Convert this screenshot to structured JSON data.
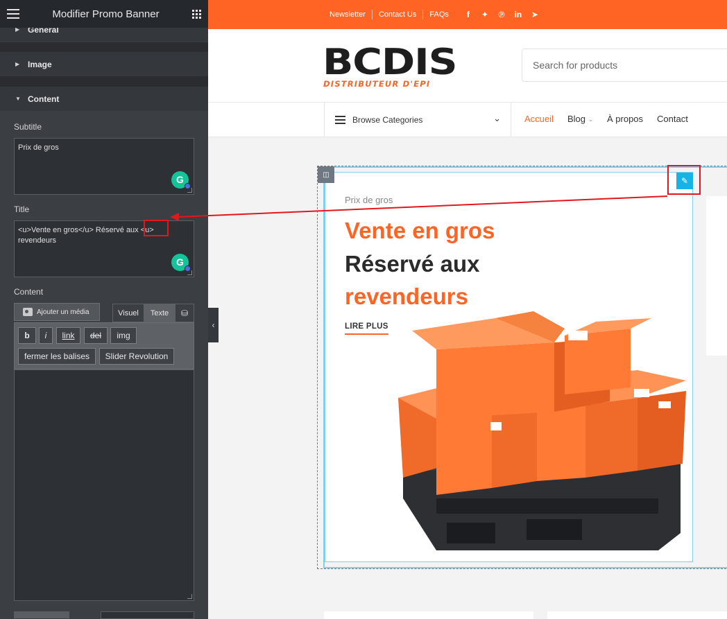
{
  "panel": {
    "title": "Modifier Promo Banner",
    "sections": {
      "general": "General",
      "image": "Image",
      "content": "Content"
    },
    "subtitle_label": "Subtitle",
    "subtitle_value": "Prix de gros",
    "title_label": "Title",
    "title_value": "<u>Vente en gros</u> Réservé aux <u> revendeurs",
    "content_label": "Content",
    "add_media": "Ajouter un média",
    "tab_visual": "Visuel",
    "tab_text": "Texte",
    "quicktags": {
      "b": "b",
      "i": "i",
      "link": "link",
      "del": "del",
      "img": "img",
      "close_tags": "fermer les balises",
      "slider": "Slider Revolution"
    },
    "content_value": ""
  },
  "topbar": {
    "links": [
      "Newsletter",
      "Contact Us",
      "FAQs"
    ],
    "social": [
      "facebook-icon",
      "twitter-icon",
      "pinterest-icon",
      "linkedin-icon",
      "telegram-icon"
    ]
  },
  "header": {
    "logo_text": "BCDIS",
    "logo_tagline": "DISTRIBUTEUR D'EPI",
    "search_placeholder": "Search for products"
  },
  "nav": {
    "browse": "Browse Categories",
    "items": [
      "Accueil",
      "Blog",
      "À propos",
      "Contact"
    ]
  },
  "banner": {
    "subtitle": "Prix de gros",
    "title_line1": "Vente en gros",
    "title_line2": "Réservé aux",
    "title_line3": "revendeurs",
    "cta": "LIRE PLUS"
  },
  "colors": {
    "accent": "#ff6424",
    "editor_dark": "#3b3e43",
    "selection": "#7fd0ec",
    "annotation": "#e3161c"
  }
}
